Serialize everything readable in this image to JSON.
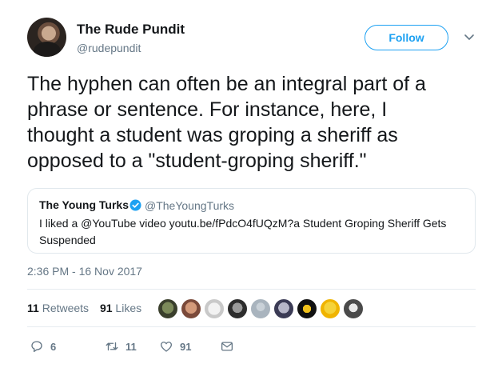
{
  "author": {
    "display_name": "The Rude Pundit",
    "handle": "@rudepundit"
  },
  "follow_label": "Follow",
  "tweet_text": "The hyphen can often be an integral part of a\nphrase or sentence. For instance, here, I\nthought a student was groping a sheriff as\nopposed to a \"student-groping sheriff.\"",
  "quote": {
    "name": "The Young Turks",
    "handle": "@TheYoungTurks",
    "text": "I liked a @YouTube video youtu.be/fPdcO4fUQzM?a Student Groping Sheriff Gets Suspended"
  },
  "timestamp": "2:36 PM - 16 Nov 2017",
  "stats": {
    "retweets_count": "11",
    "retweets_label": "Retweets",
    "likes_count": "91",
    "likes_label": "Likes"
  },
  "actions": {
    "replies": "6",
    "retweets": "11",
    "likes": "91"
  },
  "colors": {
    "accent": "#1da1f2",
    "secondary_text": "#657786",
    "border": "#e1e8ed"
  },
  "icons": [
    "caret-down-icon",
    "verified-badge-icon",
    "reply-icon",
    "retweet-icon",
    "like-icon",
    "message-icon"
  ]
}
